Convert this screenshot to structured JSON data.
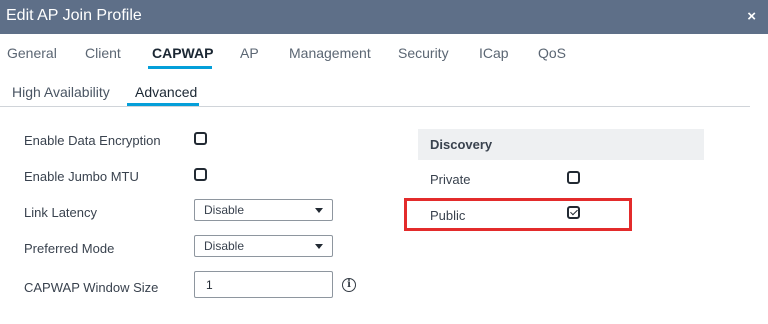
{
  "dialog": {
    "title": "Edit AP Join Profile",
    "close_symbol": "×"
  },
  "tabs": [
    "General",
    "Client",
    "CAPWAP",
    "AP",
    "Management",
    "Security",
    "ICap",
    "QoS"
  ],
  "active_tab": "CAPWAP",
  "subtabs": [
    "High Availability",
    "Advanced"
  ],
  "active_subtab": "Advanced",
  "advanced": {
    "enable_data_encryption": {
      "label": "Enable Data Encryption",
      "checked": false
    },
    "enable_jumbo_mtu": {
      "label": "Enable Jumbo MTU",
      "checked": false
    },
    "link_latency": {
      "label": "Link Latency",
      "value": "Disable"
    },
    "preferred_mode": {
      "label": "Preferred Mode",
      "value": "Disable"
    },
    "capwap_window_size": {
      "label": "CAPWAP Window Size",
      "value": "1"
    },
    "info_symbol": "i"
  },
  "discovery": {
    "header": "Discovery",
    "private": {
      "label": "Private",
      "checked": false
    },
    "public": {
      "label": "Public",
      "checked": true
    }
  },
  "colors": {
    "titlebar": "#5e6f88",
    "accent": "#049fd9",
    "highlight": "#e32b2b"
  }
}
